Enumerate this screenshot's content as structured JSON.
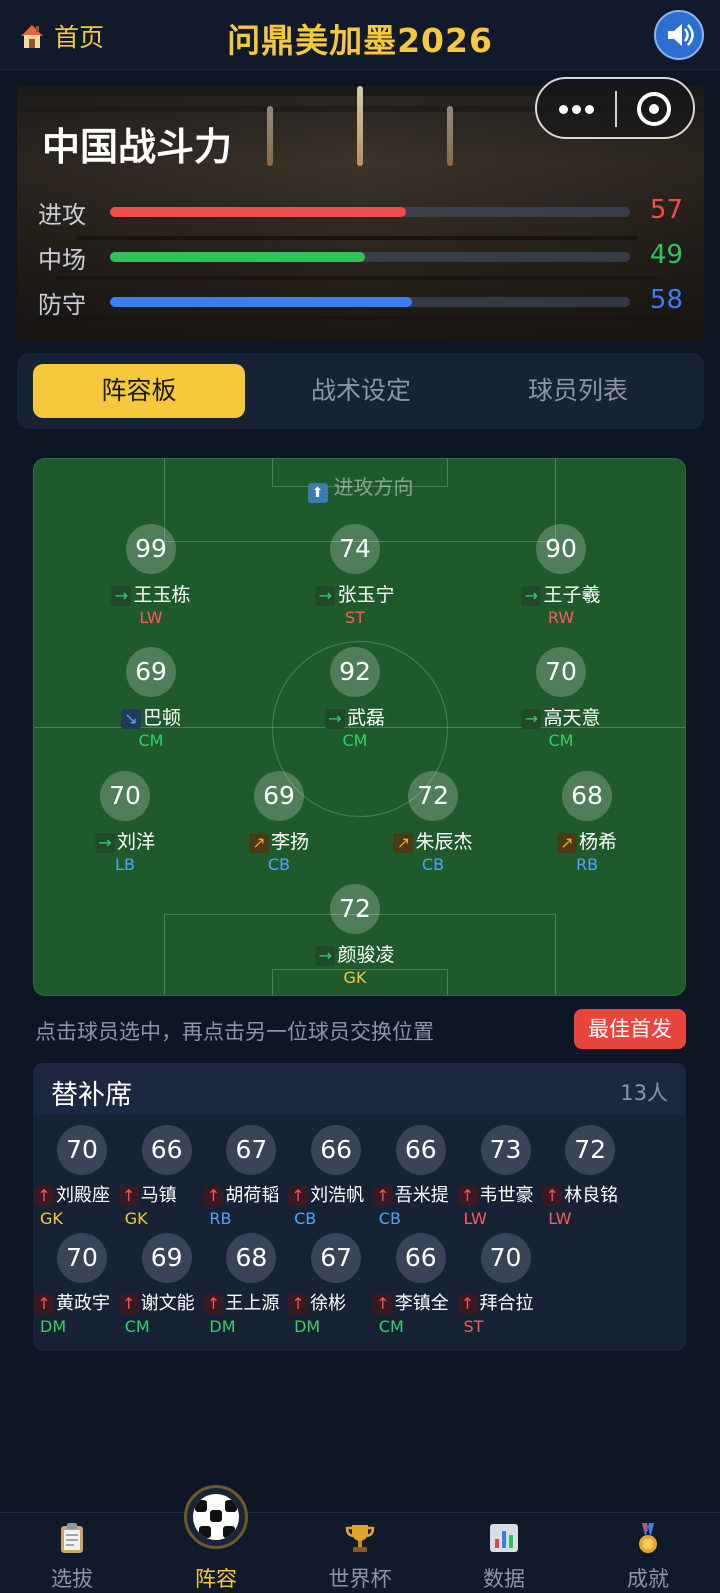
{
  "topbar": {
    "home_label": "首页",
    "title": "问鼎美加墨2026",
    "sound_icon": "speaker-icon"
  },
  "hero": {
    "title": "中国战斗力",
    "stats": [
      {
        "label": "进攻",
        "value": 57,
        "color": "#ef4c4c"
      },
      {
        "label": "中场",
        "value": 49,
        "color": "#2fc45a"
      },
      {
        "label": "防守",
        "value": 58,
        "color": "#3a7ef0"
      }
    ]
  },
  "tabs": [
    "阵容板",
    "战术设定",
    "球员列表"
  ],
  "pitch": {
    "direction_label": "进攻方向",
    "players": [
      {
        "rating": "99",
        "name": "王玉栋",
        "arrow": "flat",
        "pos": "LW",
        "pos_color": "#ff5a5a"
      },
      {
        "rating": "74",
        "name": "张玉宁",
        "arrow": "flat",
        "pos": "ST",
        "pos_color": "#ff5a5a"
      },
      {
        "rating": "90",
        "name": "王子羲",
        "arrow": "flat",
        "pos": "RW",
        "pos_color": "#ff5a5a"
      },
      {
        "rating": "69",
        "name": "巴顿",
        "arrow": "down",
        "pos": "CM",
        "pos_color": "#35d06a"
      },
      {
        "rating": "92",
        "name": "武磊",
        "arrow": "flat",
        "pos": "CM",
        "pos_color": "#35d06a"
      },
      {
        "rating": "70",
        "name": "高天意",
        "arrow": "flat",
        "pos": "CM",
        "pos_color": "#35d06a"
      },
      {
        "rating": "70",
        "name": "刘洋",
        "arrow": "flat",
        "pos": "LB",
        "pos_color": "#4da3ff"
      },
      {
        "rating": "69",
        "name": "李扬",
        "arrow": "up",
        "pos": "CB",
        "pos_color": "#4da3ff"
      },
      {
        "rating": "72",
        "name": "朱辰杰",
        "arrow": "up",
        "pos": "CB",
        "pos_color": "#4da3ff"
      },
      {
        "rating": "68",
        "name": "杨希",
        "arrow": "up",
        "pos": "RB",
        "pos_color": "#4da3ff"
      },
      {
        "rating": "72",
        "name": "颜骏凌",
        "arrow": "flat",
        "pos": "GK",
        "pos_color": "#f5c93b"
      }
    ]
  },
  "tip": "点击球员选中，再点击另一位球员交换位置",
  "best_button": "最佳首发",
  "bench": {
    "title": "替补席",
    "count": "13人",
    "players": [
      {
        "rating": "70",
        "name": "刘殿座",
        "pos": "GK",
        "pos_color": "#f5c93b"
      },
      {
        "rating": "66",
        "name": "马镇",
        "pos": "GK",
        "pos_color": "#f5c93b"
      },
      {
        "rating": "67",
        "name": "胡荷韬",
        "pos": "RB",
        "pos_color": "#4da3ff"
      },
      {
        "rating": "66",
        "name": "刘浩帆",
        "pos": "CB",
        "pos_color": "#4da3ff"
      },
      {
        "rating": "66",
        "name": "吾米提",
        "pos": "CB",
        "pos_color": "#4da3ff"
      },
      {
        "rating": "73",
        "name": "韦世豪",
        "pos": "LW",
        "pos_color": "#ff5a5a"
      },
      {
        "rating": "72",
        "name": "林良铭",
        "pos": "LW",
        "pos_color": "#ff5a5a"
      },
      {
        "rating": "70",
        "name": "黄政宇",
        "pos": "DM",
        "pos_color": "#35d06a"
      },
      {
        "rating": "69",
        "name": "谢文能",
        "pos": "CM",
        "pos_color": "#35d06a"
      },
      {
        "rating": "68",
        "name": "王上源",
        "pos": "DM",
        "pos_color": "#35d06a"
      },
      {
        "rating": "67",
        "name": "徐彬",
        "pos": "DM",
        "pos_color": "#35d06a"
      },
      {
        "rating": "66",
        "name": "李镇全",
        "pos": "CM",
        "pos_color": "#35d06a"
      },
      {
        "rating": "70",
        "name": "拜合拉",
        "pos": "ST",
        "pos_color": "#ff5a5a"
      }
    ]
  },
  "nav": [
    {
      "label": "选拔",
      "icon": "clipboard-icon"
    },
    {
      "label": "阵容",
      "icon": "soccer-ball-icon",
      "active": true
    },
    {
      "label": "世界杯",
      "icon": "trophy-icon"
    },
    {
      "label": "数据",
      "icon": "bar-chart-icon"
    },
    {
      "label": "成就",
      "icon": "medal-icon"
    }
  ]
}
